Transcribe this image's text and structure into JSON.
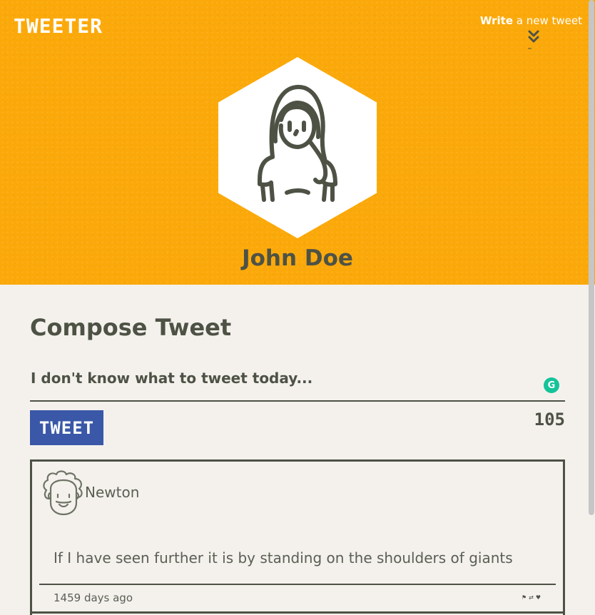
{
  "header": {
    "logo": "TWEETER",
    "write_bold": "Write",
    "write_rest": " a new tweet",
    "profile_name": "John Doe",
    "background_color": "#fba90a"
  },
  "compose": {
    "title": "Compose Tweet",
    "placeholder": "I don't know what to tweet today...",
    "button_label": "TWEET",
    "char_counter": "105",
    "grammarly_glyph": "G"
  },
  "tweets": [
    {
      "author": "Newton",
      "text": "If I have seen further it is by standing on the shoulders of giants",
      "time": "1459 days ago",
      "actions": [
        "flag-icon",
        "retweet-icon",
        "heart-icon"
      ]
    }
  ],
  "icons": {
    "chevron": "double-chevron-down-icon",
    "flag": "⚑",
    "retweet": "⇄",
    "heart": "♥"
  },
  "colors": {
    "accent": "#fba90a",
    "text": "#4d5245",
    "button": "#3a58a7",
    "page_bg": "#f4f1ed"
  }
}
